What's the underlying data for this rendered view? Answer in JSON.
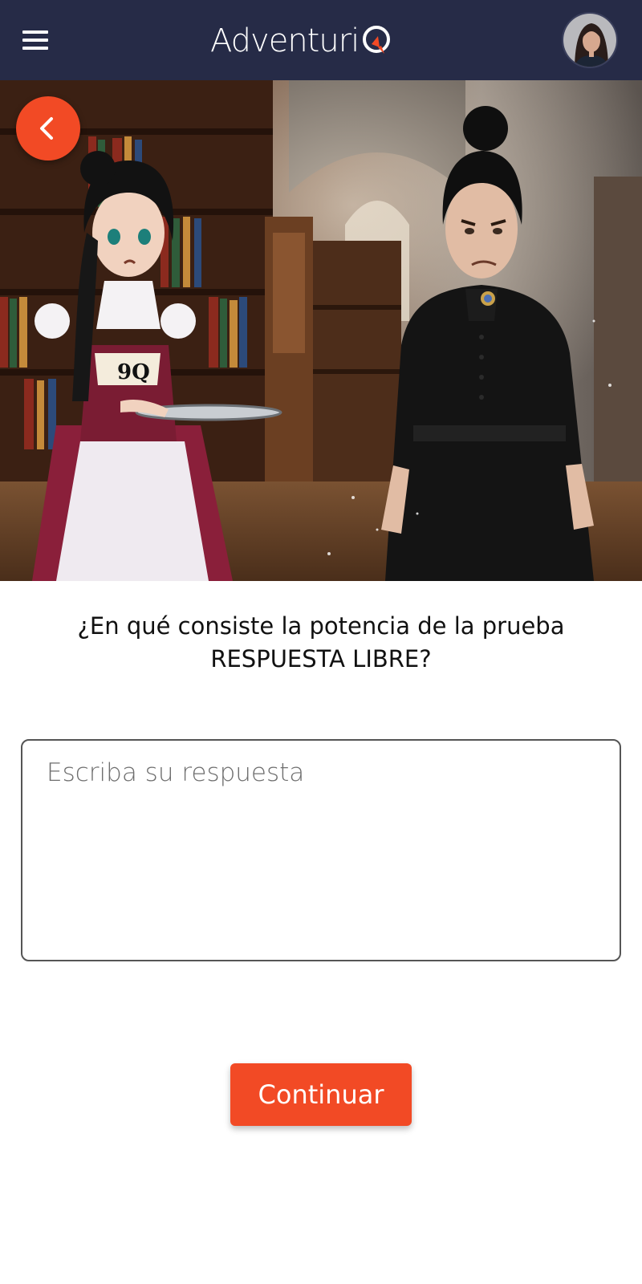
{
  "header": {
    "logo_text": "Adventuri",
    "menu_icon": "hamburger-menu-icon",
    "avatar_icon": "user-avatar"
  },
  "hero": {
    "badge_text": "9Q"
  },
  "question": {
    "line1": "¿En qué consiste la potencia de la prueba",
    "line2": "RESPUESTA LIBRE?"
  },
  "answer": {
    "placeholder": "Escriba su respuesta",
    "value": ""
  },
  "actions": {
    "continue_label": "Continuar",
    "back_icon": "chevron-left-icon"
  },
  "colors": {
    "header_bg": "#262b47",
    "accent": "#f24a25"
  }
}
